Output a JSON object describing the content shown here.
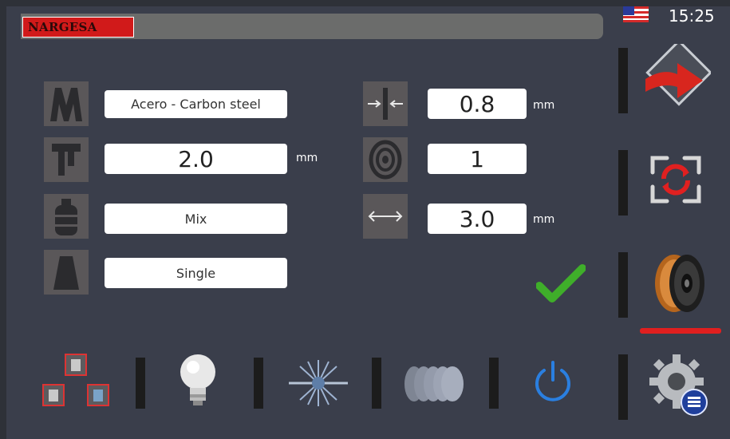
{
  "header": {
    "brand": "NARGESA",
    "time": "15:25",
    "flag_icon": "us-flag-icon"
  },
  "params_left": [
    {
      "name": "material",
      "value": "Acero - Carbon steel",
      "unit": "",
      "icon": "material-icon"
    },
    {
      "name": "thickness",
      "value": "2.0",
      "unit": "mm",
      "icon": "caliper-icon"
    },
    {
      "name": "gas",
      "value": "Mix",
      "unit": "",
      "icon": "gas-cylinder-icon"
    },
    {
      "name": "torch",
      "value": "Single",
      "unit": "",
      "icon": "torch-nozzle-icon"
    }
  ],
  "params_right": [
    {
      "name": "wire-diameter",
      "value": "0.8",
      "unit": "mm",
      "icon": "wire-diameter-icon"
    },
    {
      "name": "wire-spool",
      "value": "1",
      "unit": "",
      "icon": "spool-icon"
    },
    {
      "name": "length",
      "value": "3.0",
      "unit": "mm",
      "icon": "length-arrows-icon"
    }
  ],
  "right_menu": [
    "next-arrow-icon",
    "refresh-icon",
    "wire-spool-icon"
  ],
  "bottom_bar": [
    "windows-icon",
    "light-bulb-icon",
    "spark-icon",
    "weld-bead-icon",
    "power-icon",
    "settings-icon"
  ],
  "colors": {
    "background": "#3a3e4b",
    "accent_red": "#e01f1f",
    "check_green": "#3fae2a",
    "power_blue": "#2a7fe0"
  }
}
